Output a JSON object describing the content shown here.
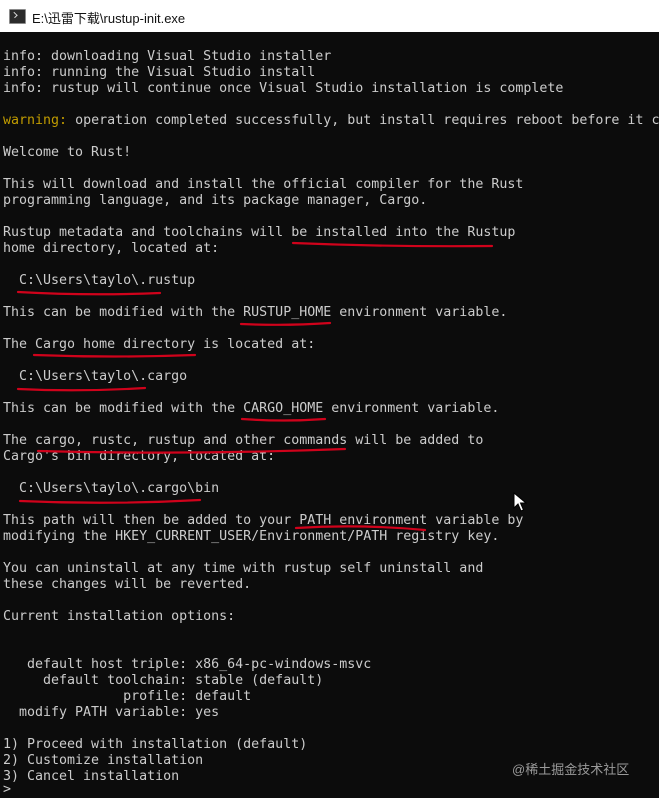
{
  "window": {
    "title": "E:\\迅雷下载\\rustup-init.exe"
  },
  "console_lines": [
    "info: downloading Visual Studio installer",
    "info: running the Visual Studio install",
    "info: rustup will continue once Visual Studio installation is complete",
    "",
    "operation completed successfully, but install requires reboot before it c",
    "",
    "Welcome to Rust!",
    "",
    "This will download and install the official compiler for the Rust",
    "programming language, and its package manager, Cargo.",
    "",
    "Rustup metadata and toolchains will be installed into the Rustup",
    "home directory, located at:",
    "",
    "  C:\\Users\\taylo\\.rustup",
    "",
    "This can be modified with the RUSTUP_HOME environment variable.",
    "",
    "The Cargo home directory is located at:",
    "",
    "  C:\\Users\\taylo\\.cargo",
    "",
    "This can be modified with the CARGO_HOME environment variable.",
    "",
    "The cargo, rustc, rustup and other commands will be added to",
    "Cargo's bin directory, located at:",
    "",
    "  C:\\Users\\taylo\\.cargo\\bin",
    "",
    "This path will then be added to your PATH environment variable by",
    "modifying the HKEY_CURRENT_USER/Environment/PATH registry key.",
    "",
    "You can uninstall at any time with rustup self uninstall and",
    "these changes will be reverted.",
    "",
    "Current installation options:",
    "",
    "",
    "   default host triple: x86_64-pc-windows-msvc",
    "     default toolchain: stable (default)",
    "               profile: default",
    "  modify PATH variable: yes",
    "",
    "1) Proceed with installation (default)",
    "2) Customize installation",
    "3) Cancel installation",
    ">"
  ],
  "warning_prefix": "warning:",
  "watermark": "@稀土掘金技术社区",
  "colors": {
    "background": "#0c0c0c",
    "text": "#cccccc",
    "warning": "#c19c00",
    "annotation": "#d0021b"
  }
}
